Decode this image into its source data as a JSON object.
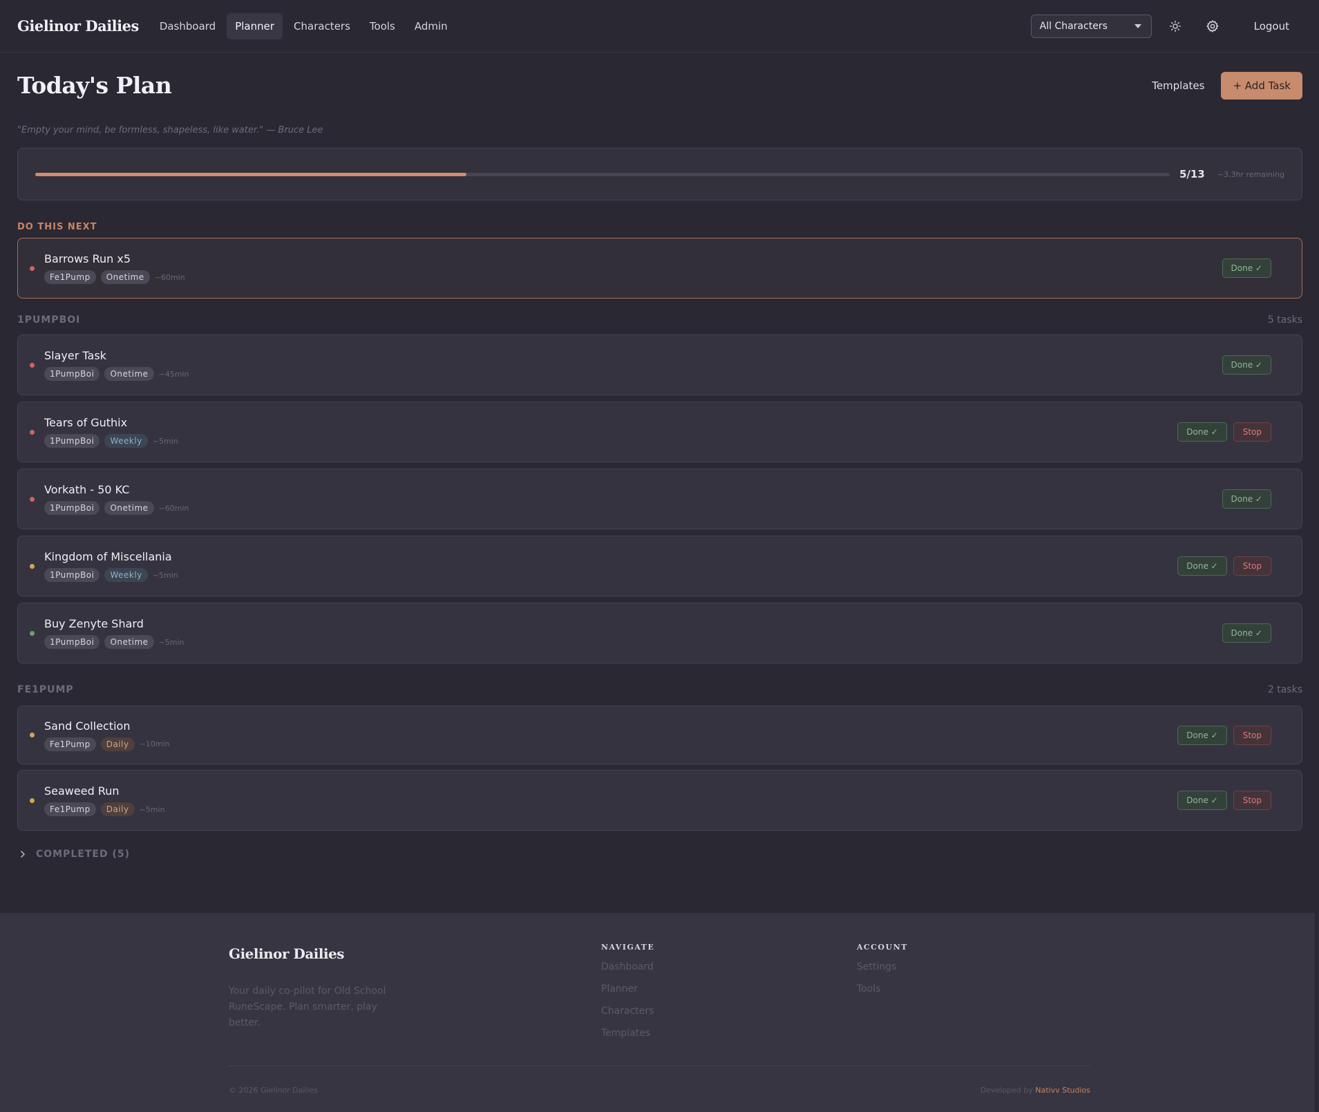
{
  "header": {
    "brand": "Gielinor Dailies",
    "nav": [
      {
        "label": "Dashboard",
        "active": false
      },
      {
        "label": "Planner",
        "active": true
      },
      {
        "label": "Characters",
        "active": false
      },
      {
        "label": "Tools",
        "active": false
      },
      {
        "label": "Admin",
        "active": false
      }
    ],
    "character_select": "All Characters",
    "logout": "Logout"
  },
  "page": {
    "title": "Today's Plan",
    "templates_label": "Templates",
    "add_task_label": "+ Add Task",
    "quote": "\"Empty your mind, be formless, shapeless, like water.\" — Bruce Lee"
  },
  "progress": {
    "done": 5,
    "total": 13,
    "count_label": "5/13",
    "remaining": "~3.3hr remaining",
    "fraction": 0.38
  },
  "next": {
    "section_label": "DO THIS NEXT",
    "task": {
      "title": "Barrows Run x5",
      "character": "Fe1Pump",
      "type": "Onetime",
      "eta": "~60min",
      "priority": "red",
      "done_label": "Done ✓"
    }
  },
  "groups": [
    {
      "name": "1PUMPBOI",
      "count": "5 tasks",
      "tasks": [
        {
          "title": "Slayer Task",
          "character": "1PumpBoi",
          "type": "Onetime",
          "eta": "~45min",
          "priority": "red",
          "done_label": "Done ✓"
        },
        {
          "title": "Tears of Guthix",
          "character": "1PumpBoi",
          "type": "Weekly",
          "eta": "~5min",
          "priority": "red",
          "done_label": "Done ✓",
          "stop_label": "Stop"
        },
        {
          "title": "Vorkath - 50 KC",
          "character": "1PumpBoi",
          "type": "Onetime",
          "eta": "~60min",
          "priority": "red",
          "done_label": "Done ✓"
        },
        {
          "title": "Kingdom of Miscellania",
          "character": "1PumpBoi",
          "type": "Weekly",
          "eta": "~5min",
          "priority": "yellow",
          "done_label": "Done ✓",
          "stop_label": "Stop"
        },
        {
          "title": "Buy Zenyte Shard",
          "character": "1PumpBoi",
          "type": "Onetime",
          "eta": "~5min",
          "priority": "green",
          "done_label": "Done ✓"
        }
      ]
    },
    {
      "name": "FE1PUMP",
      "count": "2 tasks",
      "tasks": [
        {
          "title": "Sand Collection",
          "character": "Fe1Pump",
          "type": "Daily",
          "eta": "~10min",
          "priority": "yellow",
          "done_label": "Done ✓",
          "stop_label": "Stop"
        },
        {
          "title": "Seaweed Run",
          "character": "Fe1Pump",
          "type": "Daily",
          "eta": "~5min",
          "priority": "yellow",
          "done_label": "Done ✓",
          "stop_label": "Stop"
        }
      ]
    }
  ],
  "completed_label": "COMPLETED (5)",
  "footer": {
    "brand": "Gielinor Dailies",
    "tagline": "Your daily co-pilot for Old School RuneScape. Plan smarter, play better.",
    "navigate_heading": "NAVIGATE",
    "navigate_links": [
      "Dashboard",
      "Planner",
      "Characters",
      "Templates"
    ],
    "account_heading": "ACCOUNT",
    "account_links": [
      "Settings",
      "Tools"
    ],
    "copyright": "© 2026 Gielinor Dailies",
    "developed_by": "Developed by",
    "studio": "Nativv Studios"
  },
  "colors": {
    "accent": "#c88b6e",
    "background": "#2a2833",
    "card": "#353340",
    "priority_red": "#d46260",
    "priority_yellow": "#d6a64e",
    "priority_green": "#6ba26b"
  },
  "icons": [
    "sun-icon",
    "gear-icon",
    "chevron-right-icon",
    "caret-down-icon"
  ]
}
